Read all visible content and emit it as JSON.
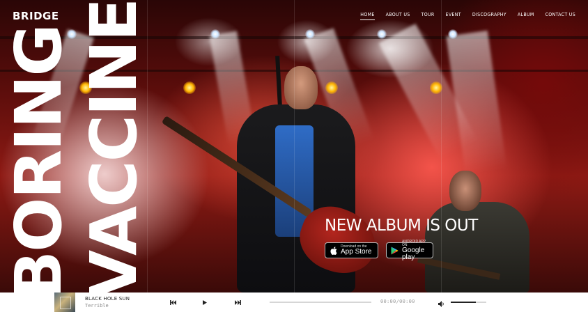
{
  "brand": {
    "logo": "BRIDGE"
  },
  "nav": {
    "items": [
      {
        "label": "HOME",
        "active": true
      },
      {
        "label": "ABOUT US",
        "active": false
      },
      {
        "label": "TOUR",
        "active": false
      },
      {
        "label": "EVENT",
        "active": false
      },
      {
        "label": "DISCOGRAPHY",
        "active": false
      },
      {
        "label": "ALBUM",
        "active": false
      },
      {
        "label": "CONTACT US",
        "active": false
      }
    ]
  },
  "hero": {
    "word_one": "BORING",
    "word_two": "VACCINES",
    "headline": "NEW ALBUM IS OUT",
    "app_store": {
      "small": "Download on the",
      "big": "App Store",
      "icon": "apple-icon"
    },
    "google_play": {
      "small": "ANDROID APP ON",
      "big": "Google play",
      "icon": "play-triangle-icon"
    }
  },
  "player": {
    "track_title": "BLACK HOLE SUN",
    "track_artist": "Terrible",
    "time": "00:00/00:00",
    "progress": 0.0,
    "volume": 0.7,
    "icons": {
      "prev": "skip-back-icon",
      "play": "play-icon",
      "next": "skip-forward-icon",
      "volume": "speaker-icon"
    }
  }
}
